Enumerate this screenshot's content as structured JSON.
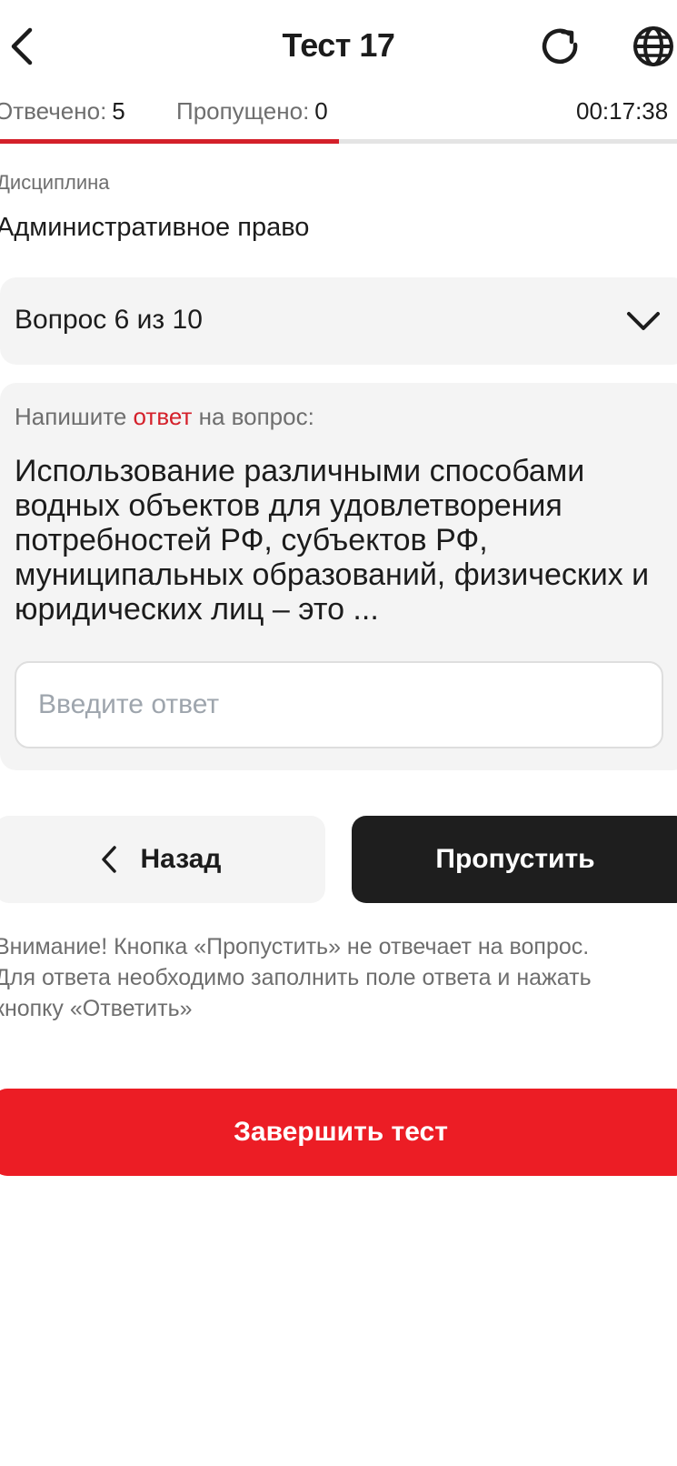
{
  "header": {
    "title": "Тест 17",
    "back_icon": "chevron-left-icon",
    "refresh_icon": "refresh-icon",
    "language_icon": "globe-icon"
  },
  "stats": {
    "answered_label": "Отвечено:",
    "answered_value": "5",
    "skipped_label": "Пропущено:",
    "skipped_value": "0",
    "timer": "00:17:38"
  },
  "progress": {
    "fraction": 0.5
  },
  "discipline": {
    "label": "Дисциплина",
    "value": "Административное право"
  },
  "question_selector": {
    "label": "Вопрос 6 из 10"
  },
  "question": {
    "prompt_before": "Напишите ",
    "prompt_accent": "ответ",
    "prompt_after": " на вопрос:",
    "text": "Использование различными способами водных объектов для удовлетворения потребностей РФ, субъектов РФ, муниципальных образований, физических и юридических лиц – это ...",
    "answer_value": "",
    "answer_placeholder": "Введите ответ"
  },
  "buttons": {
    "back_label": "Назад",
    "skip_label": "Пропустить",
    "finish_label": "Завершить тест"
  },
  "notice": {
    "line1": "Внимание! Кнопка «Пропустить» не отвечает на вопрос.",
    "line2": "Для ответа необходимо заполнить поле ответа и нажать",
    "line3": "кнопку «Ответить»"
  },
  "colors": {
    "accent": "#d4202a",
    "primary_button": "#1e1e1e",
    "finish_button": "#ec1d25",
    "card_background": "#f4f4f4"
  }
}
